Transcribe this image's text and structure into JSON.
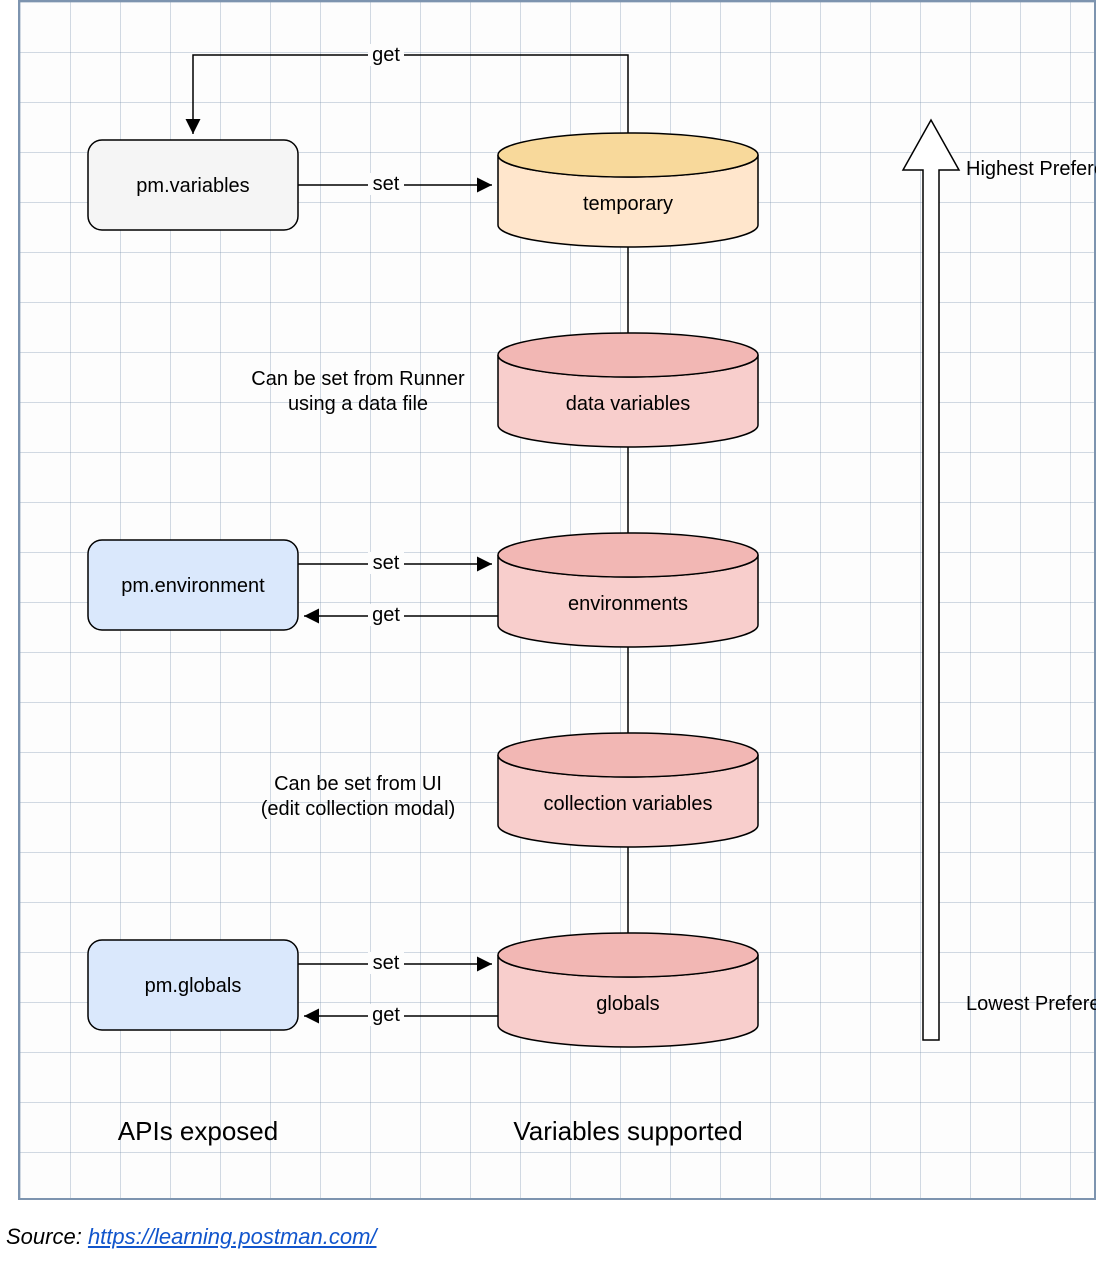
{
  "apis": {
    "variables": "pm.variables",
    "environment": "pm.environment",
    "globals": "pm.globals"
  },
  "cylinders": {
    "temporary": "temporary",
    "data": "data variables",
    "environments": "environments",
    "collection": "collection variables",
    "globals": "globals"
  },
  "notes": {
    "data_line1": "Can be set from Runner",
    "data_line2": "using a data file",
    "collection_line1": "Can be set from UI",
    "collection_line2": "(edit collection modal)"
  },
  "edges": {
    "set": "set",
    "get": "get"
  },
  "preference": {
    "high": "Highest Preference",
    "low": "Lowest Preference"
  },
  "columns": {
    "apis": "APIs exposed",
    "vars": "Variables supported"
  },
  "source": {
    "prefix": "Source: ",
    "url_text": "https://learning.postman.com/",
    "url_href": "https://learning.postman.com/"
  },
  "colors": {
    "grey_fill": "#f5f5f5",
    "blue_fill": "#dae8fc",
    "blue_stroke": "#6c8ebf",
    "pink_fill": "#f8cecc",
    "pink_stroke": "#b85450",
    "orange_fill": "#ffe6cc",
    "orange_fill_dark": "#f5c778",
    "orange_stroke": "#d6b656"
  }
}
